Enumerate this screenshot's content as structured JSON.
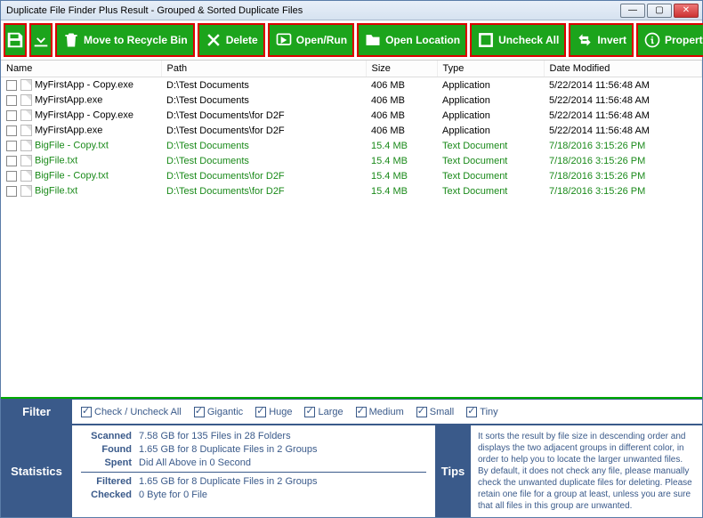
{
  "window": {
    "title": "Duplicate File Finder Plus Result - Grouped & Sorted Duplicate Files"
  },
  "toolbar": {
    "recycle": "Move to Recycle Bin",
    "delete": "Delete",
    "openrun": "Open/Run",
    "openloc": "Open Location",
    "uncheck": "Uncheck All",
    "invert": "Invert",
    "props": "Properties"
  },
  "columns": {
    "name": "Name",
    "path": "Path",
    "size": "Size",
    "type": "Type",
    "date": "Date Modified"
  },
  "files": [
    {
      "group": 0,
      "name": "MyFirstApp - Copy.exe",
      "path": "D:\\Test Documents",
      "size": "406 MB",
      "type": "Application",
      "date": "5/22/2014 11:56:48 AM"
    },
    {
      "group": 0,
      "name": "MyFirstApp.exe",
      "path": "D:\\Test Documents",
      "size": "406 MB",
      "type": "Application",
      "date": "5/22/2014 11:56:48 AM"
    },
    {
      "group": 0,
      "name": "MyFirstApp - Copy.exe",
      "path": "D:\\Test Documents\\for D2F",
      "size": "406 MB",
      "type": "Application",
      "date": "5/22/2014 11:56:48 AM"
    },
    {
      "group": 0,
      "name": "MyFirstApp.exe",
      "path": "D:\\Test Documents\\for D2F",
      "size": "406 MB",
      "type": "Application",
      "date": "5/22/2014 11:56:48 AM"
    },
    {
      "group": 1,
      "name": "BigFile - Copy.txt",
      "path": "D:\\Test Documents",
      "size": "15.4 MB",
      "type": "Text Document",
      "date": "7/18/2016 3:15:26 PM"
    },
    {
      "group": 1,
      "name": "BigFile.txt",
      "path": "D:\\Test Documents",
      "size": "15.4 MB",
      "type": "Text Document",
      "date": "7/18/2016 3:15:26 PM"
    },
    {
      "group": 1,
      "name": "BigFile - Copy.txt",
      "path": "D:\\Test Documents\\for D2F",
      "size": "15.4 MB",
      "type": "Text Document",
      "date": "7/18/2016 3:15:26 PM"
    },
    {
      "group": 1,
      "name": "BigFile.txt",
      "path": "D:\\Test Documents\\for D2F",
      "size": "15.4 MB",
      "type": "Text Document",
      "date": "7/18/2016 3:15:26 PM"
    }
  ],
  "filter": {
    "label": "Filter",
    "checkall": "Check / Uncheck All",
    "opts": [
      "Gigantic",
      "Huge",
      "Large",
      "Medium",
      "Small",
      "Tiny"
    ]
  },
  "stats": {
    "label": "Statistics",
    "rows": {
      "Scanned": "7.58 GB for 135 Files in 28 Folders",
      "Found": "1.65 GB for 8 Duplicate Files in 2 Groups",
      "Spent": "Did All Above in 0 Second",
      "Filtered": "1.65 GB for 8 Duplicate Files in 2 Groups",
      "Checked": "0 Byte for 0 File"
    }
  },
  "tips": {
    "label": "Tips",
    "text": "It sorts the result by file size in descending order and displays the two adjacent groups in different color, in order to help you to locate the larger unwanted files. By default, it does not check any file, please manually check the unwanted duplicate files for deleting. Please retain one file for a group at least, unless you are sure that all files in this group are unwanted."
  }
}
